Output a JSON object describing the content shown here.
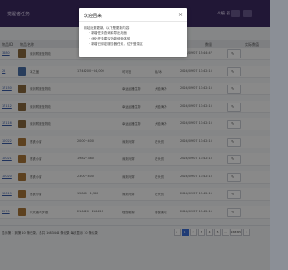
{
  "app": {
    "title": "觉醒者任务",
    "top_right": "4 编 器"
  },
  "table": {
    "headers": [
      "物品ID",
      "物品名称",
      "",
      "",
      "",
      "",
      "",
      "数量",
      "实际数值"
    ],
    "rows": [
      {
        "id": "3680",
        "name": "双剑附魔圣物能",
        "a": "",
        "b": "",
        "c": "",
        "time": "2024/09/07 15:44:47"
      },
      {
        "id": "25",
        "name": "冰之盖",
        "a": "1744200~54,000",
        "b": "可可品",
        "c": "纸/冰",
        "time": "2024/09/07 13:42:15"
      },
      {
        "id": "17150",
        "name": "双剑附魔圣物能",
        "a": "",
        "b": "幸运武器生物",
        "c": "大脸海净",
        "time": "2024/09/07 13:42:15"
      },
      {
        "id": "17112",
        "name": "双剑附魔圣物能",
        "a": "",
        "b": "幸运武器生物",
        "c": "大脸海净",
        "time": "2024/09/07 13:42:15"
      },
      {
        "id": "17116",
        "name": "双剑附魔圣物能",
        "a": "",
        "b": "幸运武器生物",
        "c": "大脸海净",
        "time": "2024/09/07 13:42:15"
      },
      {
        "id": "10022",
        "name": "黑铁小窗",
        "a": "2000~400",
        "b": "深刻马穿",
        "c": "石头仿",
        "time": "2024/09/07 13:42:15"
      },
      {
        "id": "10021",
        "name": "黑铁小窗",
        "a": "1982~380",
        "b": "深刻马穿",
        "c": "石头仿",
        "time": "2024/09/07 13:42:15"
      },
      {
        "id": "10020",
        "name": "黑铁小窗",
        "a": "2300~400",
        "b": "深刻马穿",
        "c": "石头仿",
        "time": "2024/09/07 13:42:15"
      },
      {
        "id": "10019",
        "name": "黑铁小窗",
        "a": "15840~1,380",
        "b": "深刻马穿",
        "c": "石头仿",
        "time": "2024/09/07 13:42:15"
      },
      {
        "id": "2270",
        "name": "乐天者木步履",
        "a": "216420~216420",
        "b": "理想看源",
        "c": "参视某项",
        "time": "2024/09/07 13:42:15"
      }
    ]
  },
  "pager": {
    "summary": "显示第 1 到第 10 条记录，总共 1683444 条记录 每页显示 10 条记录",
    "pages": [
      "‹",
      "1",
      "2",
      "3",
      "4",
      "5",
      "...",
      "168345",
      "›"
    ],
    "active": "1"
  },
  "dialog": {
    "title": "欢迎回来！",
    "close": "×",
    "intro": "网站近期更新，以下是更新内容：",
    "items": [
      "· 新增任务查询和导出页面",
      "· 优化任务建议功能使用体验",
      "· 新增已绑定服务器任务，位于登录区"
    ]
  }
}
